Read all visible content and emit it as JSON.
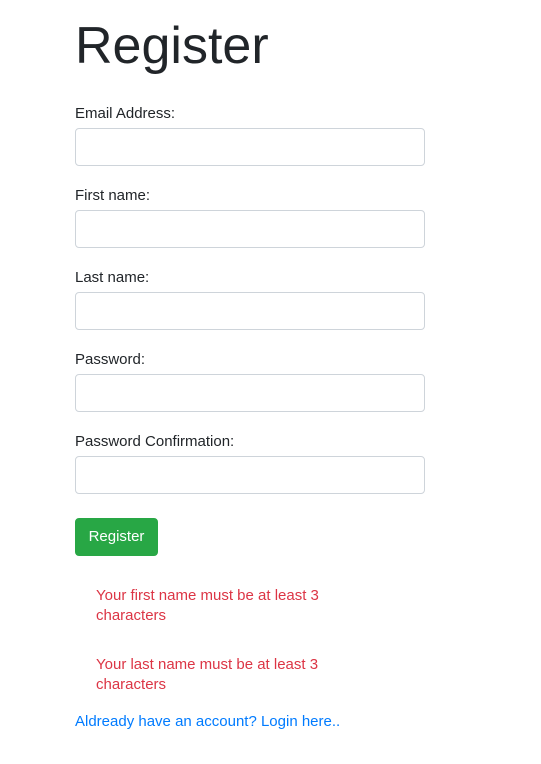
{
  "page": {
    "title": "Register"
  },
  "form": {
    "fields": [
      {
        "label": "Email Address:",
        "value": "",
        "placeholder": ""
      },
      {
        "label": "First name:",
        "value": "",
        "placeholder": ""
      },
      {
        "label": "Last name:",
        "value": "",
        "placeholder": ""
      },
      {
        "label": "Password:",
        "value": "",
        "placeholder": ""
      },
      {
        "label": "Password Confirmation:",
        "value": "",
        "placeholder": ""
      }
    ],
    "submit_label": "Register"
  },
  "errors": [
    "Your first name must be at least 3 characters",
    "Your last name must be at least 3 characters"
  ],
  "login_link": "Aldready have an account? Login here..",
  "colors": {
    "primary_button": "#28a745",
    "error_text": "#dc3545",
    "link": "#007bff"
  }
}
